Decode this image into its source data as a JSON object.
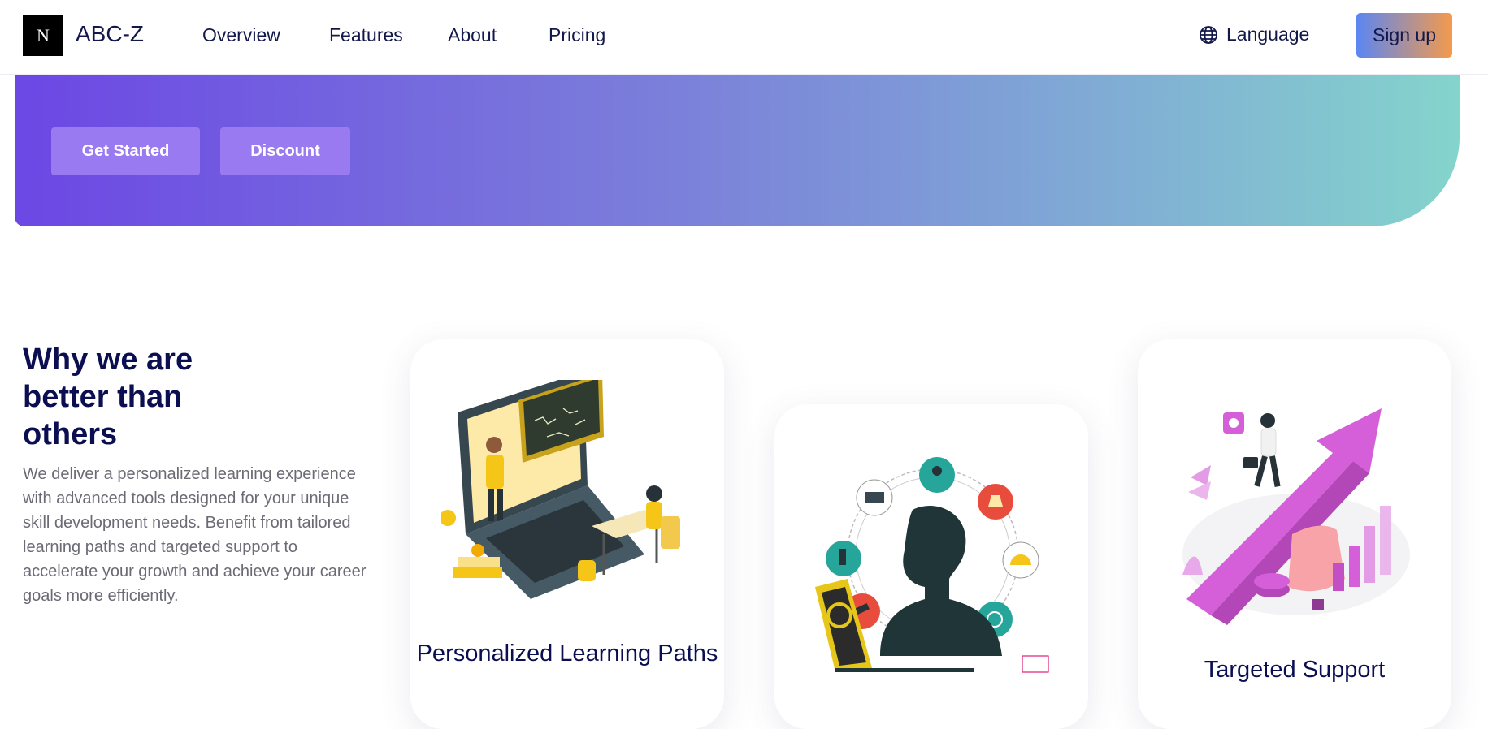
{
  "nav": {
    "brand_letter": "N",
    "brand": "ABC-Z",
    "links": [
      "Overview",
      "Features",
      "About",
      "Pricing"
    ],
    "language": "Language",
    "signup": "Sign up"
  },
  "hero": {
    "get_started": "Get Started",
    "discount": "Discount"
  },
  "why": {
    "title": "Why we are better than others",
    "description": "We deliver a personalized learning experience with advanced tools designed for your unique skill development needs. Benefit from tailored learning paths and targeted support to accelerate your growth and achieve your career goals more efficiently."
  },
  "cards": [
    {
      "title": "Personalized Learning Paths"
    },
    {
      "title": ""
    },
    {
      "title": "Targeted Support"
    }
  ],
  "colors": {
    "navy": "#0b0f52",
    "hero_start": "#6c47e4",
    "hero_end": "#84d4cc",
    "signup_start": "#5b86f2",
    "signup_end": "#f49a4c"
  }
}
